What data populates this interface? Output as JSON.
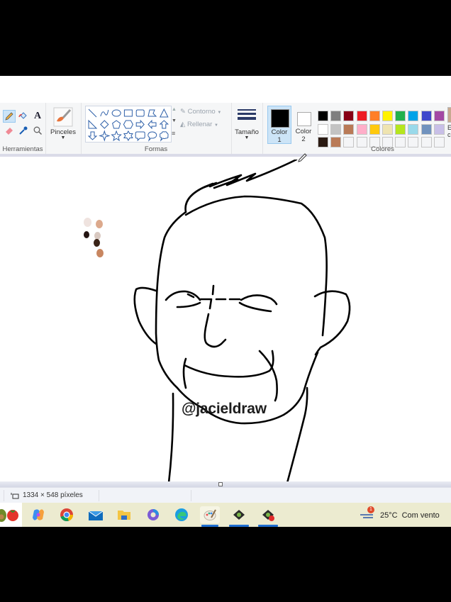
{
  "ribbon": {
    "groups": {
      "tools": {
        "label": "Herramientas"
      },
      "brushes": {
        "label": "Pinceles"
      },
      "shapes": {
        "label": "Formas",
        "outline_label": "Contorno",
        "fill_label": "Rellenar"
      },
      "size": {
        "label": "Tamaño"
      },
      "color1": {
        "label_line1": "Color",
        "label_line2": "1",
        "color": "#000000"
      },
      "color2": {
        "label_line1": "Color",
        "label_line2": "2",
        "color": "#ffffff"
      },
      "colors": {
        "label": "Colores",
        "edit_label_partial": "E",
        "edit_label_partial2": "c"
      }
    },
    "tools": [
      {
        "name": "pencil",
        "selected": true
      },
      {
        "name": "fill"
      },
      {
        "name": "text"
      },
      {
        "name": "eraser"
      },
      {
        "name": "color-picker"
      },
      {
        "name": "magnifier"
      }
    ],
    "shapes": [
      "line",
      "curve",
      "oval",
      "rectangle",
      "rounded-rectangle",
      "polygon",
      "triangle",
      "right-triangle",
      "diamond",
      "pentagon",
      "hexagon",
      "right-arrow",
      "left-arrow",
      "up-arrow",
      "down-arrow",
      "four-point-star",
      "five-point-star",
      "six-point-star",
      "rounded-callout",
      "oval-callout",
      "cloud-callout"
    ],
    "palette": [
      [
        "#000000",
        "#7f7f7f",
        "#880015",
        "#ed1c24",
        "#ff7f27",
        "#fff200",
        "#22b14c",
        "#00a2e8",
        "#3f48cc",
        "#a349a4"
      ],
      [
        "#ffffff",
        "#c3c3c3",
        "#b97a57",
        "#ffaec9",
        "#ffc90e",
        "#efe4b0",
        "#b5e61d",
        "#99d9ea",
        "#7092be",
        "#c8bfe7"
      ],
      [
        "#2a1a12",
        "#b97a57",
        "#f4f5f7",
        "#f4f5f7",
        "#f4f5f7",
        "#f4f5f7",
        "#f4f5f7",
        "#f4f5f7",
        "#f4f5f7",
        "#f4f5f7"
      ]
    ]
  },
  "canvas": {
    "watermark": "@jacieldraw",
    "paint_dots": [
      "#efe3df",
      "#dca98c",
      "#241512",
      "#d8c8c0",
      "#3a2418",
      "#c88660"
    ]
  },
  "status": {
    "canvas_size": "1334 × 548 píxeles"
  },
  "taskbar": {
    "apps": [
      "avocado-app",
      "tomato-app",
      "copilot",
      "chrome",
      "mail",
      "file-explorer",
      "office",
      "edge",
      "paint",
      "app-1",
      "app-2"
    ],
    "weather": {
      "temp": "25°C",
      "desc": "Com vento",
      "badge": "1"
    }
  }
}
